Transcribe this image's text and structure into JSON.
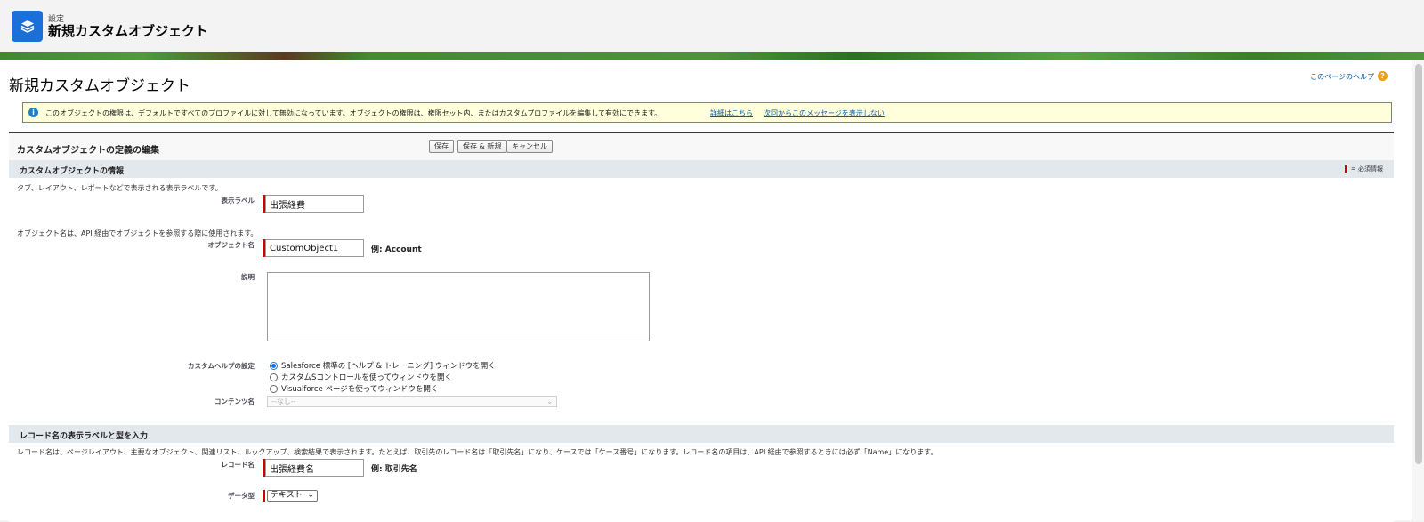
{
  "header": {
    "breadcrumb": "設定",
    "title": "新規カスタムオブジェクト",
    "icon": "layers-icon"
  },
  "page": {
    "title": "新規カスタムオブジェクト",
    "help_link": "このページのヘルプ",
    "info_message": "このオブジェクトの権限は、デフォルトですべてのプロファイルに対して無効になっています。オブジェクトの権限は、権限セット内、またはカスタムプロファイルを編集して有効にできます。",
    "info_link_details": "詳細はこちら",
    "info_link_dismiss": "次回からこのメッセージを表示しない"
  },
  "edit": {
    "title": "カスタムオブジェクトの定義の編集",
    "buttons": {
      "save": "保存",
      "save_new": "保存 & 新規",
      "cancel": "キャンセル"
    }
  },
  "section_info": {
    "title": "カスタムオブジェクトの情報",
    "required_legend": "= 必須情報",
    "label_hint": "タブ、レイアウト、レポートなどで表示される表示ラベルです。",
    "label_label": "表示ラベル",
    "label_value": "出張経費",
    "api_hint": "オブジェクト名は、API 経由でオブジェクトを参照する際に使用されます。",
    "object_name_label": "オブジェクト名",
    "object_name_value": "CustomObject1",
    "object_name_example": "例:  Account",
    "description_label": "説明",
    "custom_help_label": "カスタムヘルプの設定",
    "help_options": [
      "Salesforce 標準の [ヘルプ & トレーニング] ウィンドウを開く",
      "カスタムSコントロールを使ってウィンドウを開く",
      "Visualforce ページを使ってウィンドウを開く"
    ],
    "help_selected_index": 0,
    "content_name_label": "コンテンツ名",
    "content_name_value": "--なし--"
  },
  "section_record": {
    "title": "レコード名の表示ラベルと型を入力",
    "hint": "レコード名は、ページレイアウト、主要なオブジェクト、関連リスト、ルックアップ、検索結果で表示されます。たとえば、取引先のレコード名は「取引先名」になり、ケースでは「ケース番号」になります。レコード名の項目は、API 経由で参照するときには必ず「Name」になります。",
    "record_name_label": "レコード名",
    "record_name_value": "出張経費名",
    "record_name_example": "例:  取引先名",
    "data_type_label": "データ型",
    "data_type_value": "テキスト"
  },
  "colors": {
    "accent": "#1b6fd9",
    "required": "#cc0000",
    "section_header": "#e3e8ed",
    "info_bg": "#ffffdc"
  }
}
